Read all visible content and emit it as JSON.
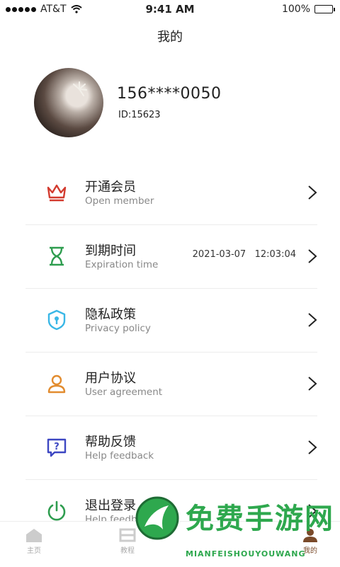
{
  "status_bar": {
    "carrier": "AT&T",
    "time": "9:41 AM",
    "battery": "100%"
  },
  "page": {
    "title": "我的"
  },
  "profile": {
    "phone": "156****0050",
    "id": "ID:15623"
  },
  "menu": [
    {
      "zh": "开通会员",
      "en": "Open member",
      "icon": "crown-icon",
      "color": "#d33b2f",
      "value": ""
    },
    {
      "zh": "到期时间",
      "en": "Expiration time",
      "icon": "hourglass-icon",
      "color": "#2e9d4f",
      "value": "2021-03-07   12:03:04"
    },
    {
      "zh": "隐私政策",
      "en": "Privacy policy",
      "icon": "shield-icon",
      "color": "#3ab7e6",
      "value": ""
    },
    {
      "zh": "用户协议",
      "en": "User agreement",
      "icon": "user-icon",
      "color": "#e28c2f",
      "value": ""
    },
    {
      "zh": "帮助反馈",
      "en": "Help feedback",
      "icon": "help-icon",
      "color": "#3d47c2",
      "value": ""
    },
    {
      "zh": "退出登录",
      "en": "Help feedback",
      "icon": "power-icon",
      "color": "#2e9d4f",
      "value": ""
    }
  ],
  "tabbar": {
    "items": [
      {
        "label": "主页",
        "icon": "home-icon"
      },
      {
        "label": "教程",
        "icon": "tutorial-icon"
      },
      {
        "label": "我的",
        "icon": "profile-icon"
      }
    ]
  },
  "watermark": {
    "text": "免费手游网",
    "domain": "MIANFEISHOUYOUWANG"
  }
}
